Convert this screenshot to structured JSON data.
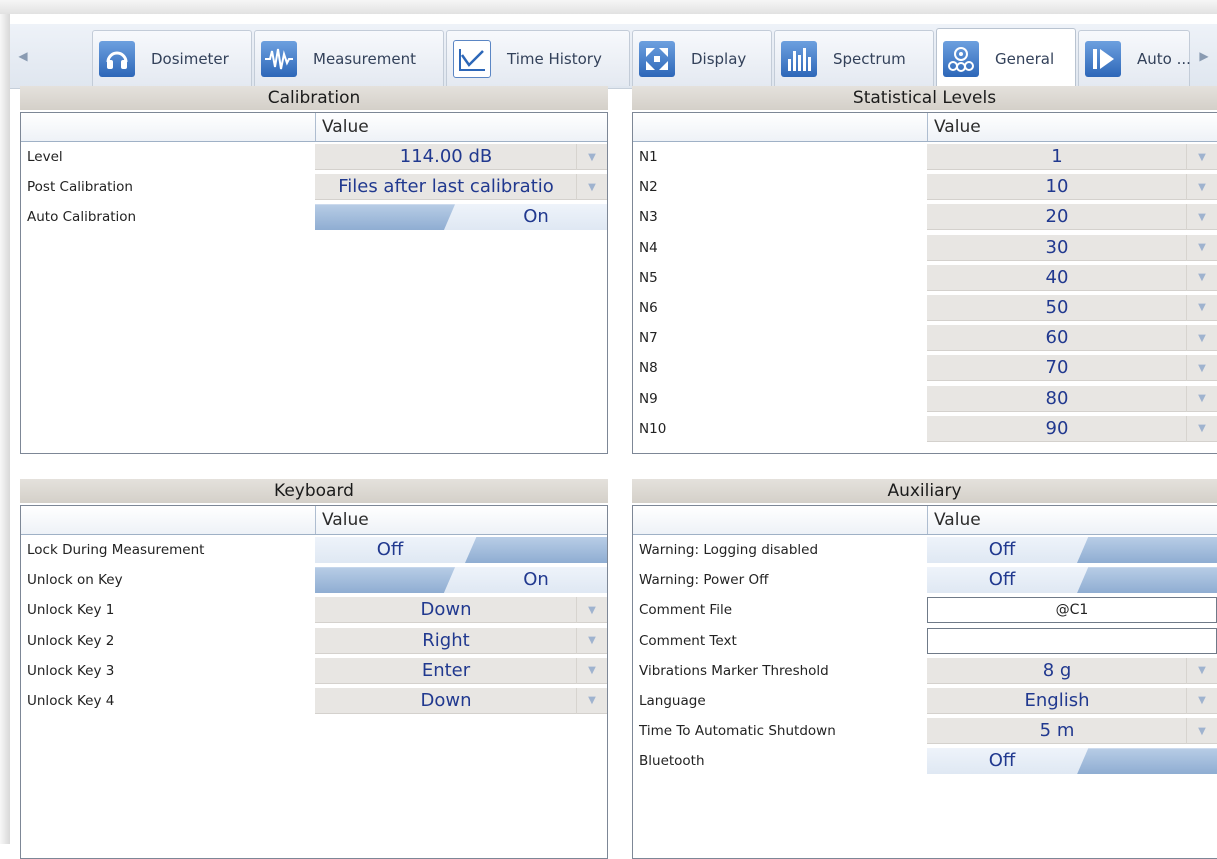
{
  "tabs": [
    {
      "label": "Dosimeter",
      "icon": "headphones-icon",
      "active": false
    },
    {
      "label": "Measurement",
      "icon": "waveform-icon",
      "active": false
    },
    {
      "label": "Time History",
      "icon": "line-chart-icon",
      "active": false
    },
    {
      "label": "Display",
      "icon": "expand-arrows-icon",
      "active": false
    },
    {
      "label": "Spectrum",
      "icon": "bar-spectrum-icon",
      "active": false
    },
    {
      "label": "General",
      "icon": "gears-icon",
      "active": true
    },
    {
      "label": "Auto ...",
      "icon": "play-icon",
      "active": false
    }
  ],
  "value_header": "Value",
  "calibration": {
    "title": "Calibration",
    "rows": [
      {
        "label": "Level",
        "type": "dropdown",
        "value": "114.00 dB"
      },
      {
        "label": "Post Calibration",
        "type": "dropdown",
        "value": "Files after last calibratio"
      },
      {
        "label": "Auto Calibration",
        "type": "toggle",
        "value": "On",
        "on": true
      }
    ]
  },
  "statistical": {
    "title": "Statistical Levels",
    "rows": [
      {
        "label": "N1",
        "value": "1"
      },
      {
        "label": "N2",
        "value": "10"
      },
      {
        "label": "N3",
        "value": "20"
      },
      {
        "label": "N4",
        "value": "30"
      },
      {
        "label": "N5",
        "value": "40"
      },
      {
        "label": "N6",
        "value": "50"
      },
      {
        "label": "N7",
        "value": "60"
      },
      {
        "label": "N8",
        "value": "70"
      },
      {
        "label": "N9",
        "value": "80"
      },
      {
        "label": "N10",
        "value": "90"
      }
    ]
  },
  "keyboard": {
    "title": "Keyboard",
    "rows": [
      {
        "label": "Lock During Measurement",
        "type": "toggle",
        "value": "Off",
        "on": false
      },
      {
        "label": "Unlock on Key",
        "type": "toggle",
        "value": "On",
        "on": true
      },
      {
        "label": "Unlock Key 1",
        "type": "dropdown",
        "value": "Down"
      },
      {
        "label": "Unlock Key 2",
        "type": "dropdown",
        "value": "Right"
      },
      {
        "label": "Unlock Key 3",
        "type": "dropdown",
        "value": "Enter"
      },
      {
        "label": "Unlock Key 4",
        "type": "dropdown",
        "value": "Down"
      }
    ]
  },
  "auxiliary": {
    "title": "Auxiliary",
    "rows": [
      {
        "label": "Warning: Logging disabled",
        "type": "toggle",
        "value": "Off",
        "on": false
      },
      {
        "label": "Warning: Power Off",
        "type": "toggle",
        "value": "Off",
        "on": false
      },
      {
        "label": "Comment File",
        "type": "text",
        "value": "@C1"
      },
      {
        "label": "Comment Text",
        "type": "text",
        "value": ""
      },
      {
        "label": "Vibrations Marker Threshold",
        "type": "dropdown",
        "value": "8 g"
      },
      {
        "label": "Language",
        "type": "dropdown",
        "value": "English"
      },
      {
        "label": "Time To Automatic Shutdown",
        "type": "dropdown",
        "value": "5 m"
      },
      {
        "label": "Bluetooth",
        "type": "toggle",
        "value": "Off",
        "on": false
      }
    ]
  },
  "colors": {
    "value_text": "#21398f",
    "toggle_knob": "#9db8d9",
    "dropdown_bg": "#e8e6e3"
  }
}
